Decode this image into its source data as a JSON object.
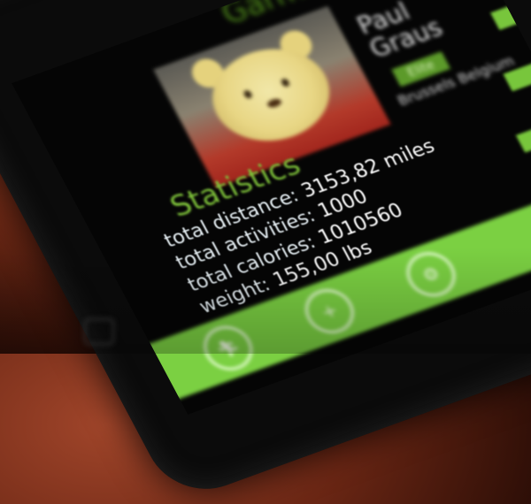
{
  "app": {
    "title": "Garmin"
  },
  "profile": {
    "name": "Paul Graus",
    "badge": "Elite",
    "location": "Brussels Belgium"
  },
  "statistics": {
    "title": "Statistics",
    "items": [
      {
        "label": "total distance:",
        "value": "3153,82 miles"
      },
      {
        "label": "total activities:",
        "value": "1000"
      },
      {
        "label": "total calories:",
        "value": "1010560"
      },
      {
        "label": "weight:",
        "value": "155,00 lbs"
      }
    ]
  },
  "appbar": {
    "buttons": [
      {
        "icon": "runner-icon"
      },
      {
        "icon": "add-icon"
      },
      {
        "icon": "settings-icon"
      }
    ]
  },
  "colors": {
    "accent": "#7bd042",
    "text": "#e5eef3",
    "background": "#050505"
  }
}
